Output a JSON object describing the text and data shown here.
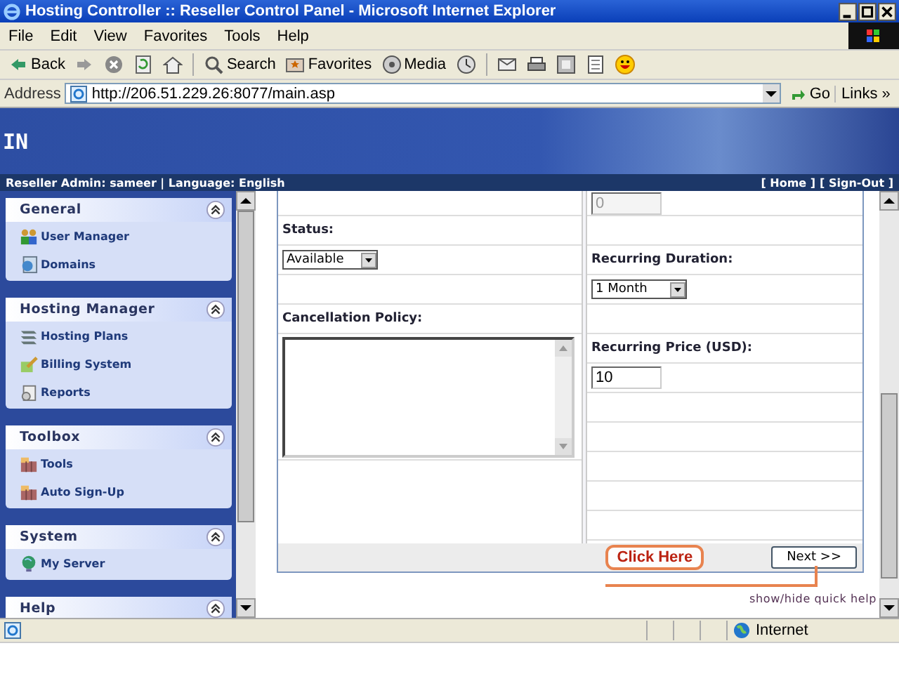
{
  "window": {
    "title": "Hosting Controller :: Reseller Control Panel - Microsoft Internet Explorer"
  },
  "menu": [
    "File",
    "Edit",
    "View",
    "Favorites",
    "Tools",
    "Help"
  ],
  "toolbar": [
    {
      "kind": "back",
      "label": "Back"
    },
    {
      "kind": "forward"
    },
    {
      "kind": "stop"
    },
    {
      "kind": "refresh"
    },
    {
      "kind": "home"
    },
    {
      "kind": "search",
      "label": "Search"
    },
    {
      "kind": "favorites",
      "label": "Favorites"
    },
    {
      "kind": "media",
      "label": "Media"
    },
    {
      "kind": "history"
    },
    {
      "kind": "mail"
    },
    {
      "kind": "print"
    },
    {
      "kind": "edit"
    },
    {
      "kind": "discuss"
    },
    {
      "kind": "messenger"
    }
  ],
  "address": {
    "label": "Address",
    "url": "http://206.51.229.26:8077/main.asp",
    "go": "Go",
    "links": "Links",
    "more": "»"
  },
  "banner": {
    "text": "IN",
    "user_info": "Reseller Admin: sameer | Language: English",
    "links": [
      "[ Home ]",
      "[ Sign-Out ]"
    ]
  },
  "sidebar": [
    {
      "title": "General",
      "items": [
        {
          "kind": "users",
          "label": "User Manager"
        },
        {
          "kind": "globe-doc",
          "label": "Domains"
        }
      ]
    },
    {
      "title": "Hosting Manager",
      "items": [
        {
          "kind": "plans",
          "label": "Hosting Plans"
        },
        {
          "kind": "billing",
          "label": "Billing System"
        },
        {
          "kind": "reports",
          "label": "Reports"
        }
      ]
    },
    {
      "title": "Toolbox",
      "items": [
        {
          "kind": "box",
          "label": "Tools"
        },
        {
          "kind": "box",
          "label": "Auto Sign-Up"
        }
      ]
    },
    {
      "title": "System",
      "items": [
        {
          "kind": "globe",
          "label": "My Server"
        }
      ]
    },
    {
      "title": "Help"
    }
  ],
  "form": {
    "left": [
      {
        "kind": "blank"
      },
      {
        "kind": "label",
        "text": "Status:"
      },
      {
        "kind": "select",
        "value": "Available"
      },
      {
        "kind": "blank"
      },
      {
        "kind": "label",
        "text": "Cancellation Policy:"
      },
      {
        "kind": "textarea"
      },
      {
        "kind": "blank"
      }
    ],
    "right": [
      {
        "kind": "input",
        "value": "0",
        "disabled": true
      },
      {
        "kind": "blank"
      },
      {
        "kind": "label",
        "text": "Recurring Duration:"
      },
      {
        "kind": "select",
        "value": "1 Month"
      },
      {
        "kind": "blank"
      },
      {
        "kind": "label",
        "text": "Recurring Price (USD):"
      },
      {
        "kind": "input",
        "value": "10",
        "disabled": false
      },
      {
        "kind": "blank"
      },
      {
        "kind": "blank"
      },
      {
        "kind": "blank"
      },
      {
        "kind": "blank"
      },
      {
        "kind": "blank"
      }
    ],
    "callout": "Click Here",
    "next": "Next >>"
  },
  "help_link": "show/hide quick help",
  "status_bar": {
    "zone": "Internet"
  }
}
